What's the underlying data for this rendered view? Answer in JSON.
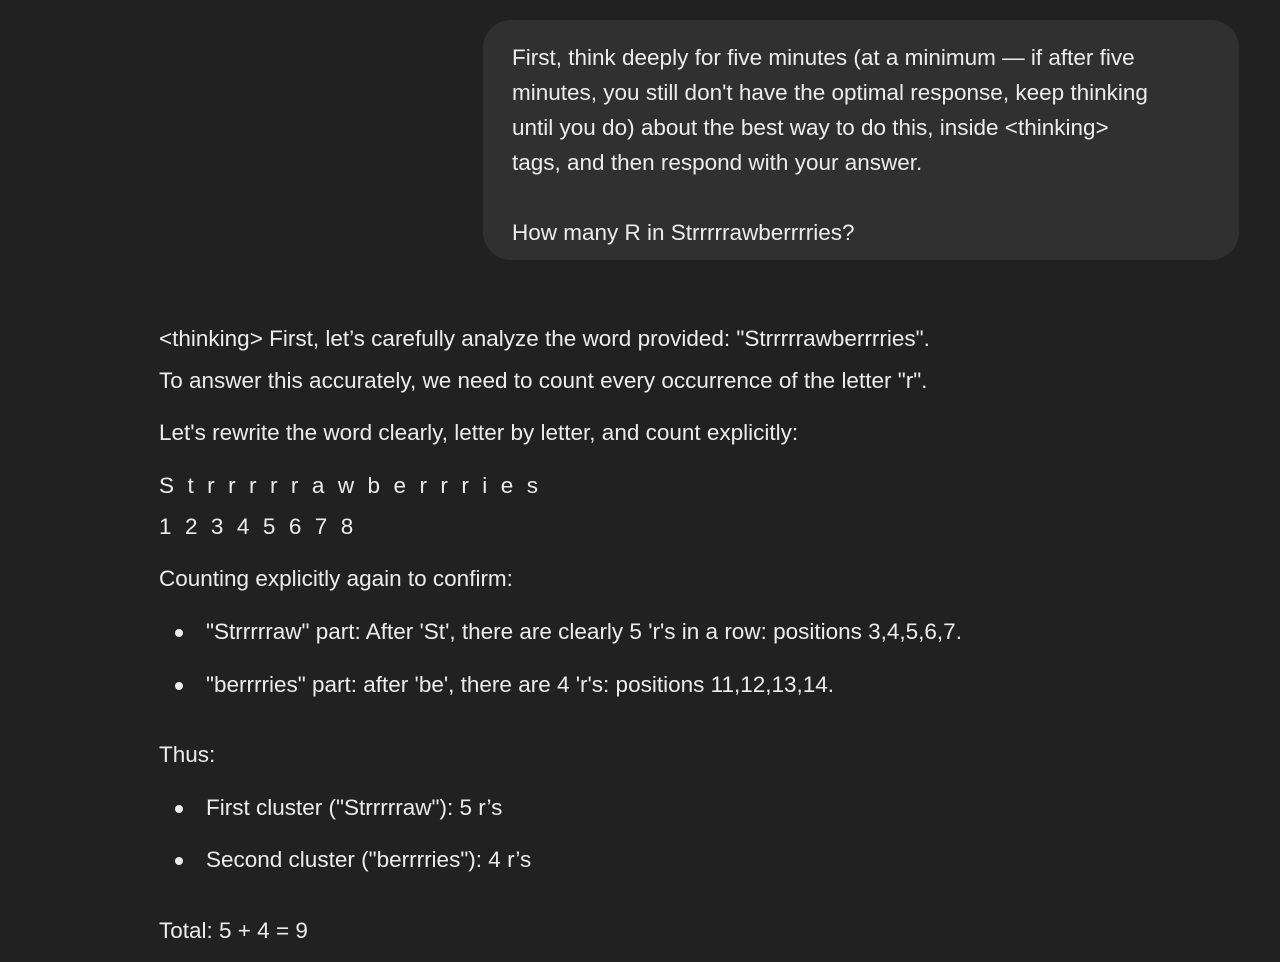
{
  "user_message": {
    "lines": [
      "First, think deeply for five minutes (at a minimum — if after five",
      "minutes, you still don't have the optimal response, keep thinking",
      "until you do) about the best way to do this, inside <thinking>",
      "tags, and then respond with your answer."
    ],
    "question": "How many R in Strrrrrawberrrries?"
  },
  "assistant_message": {
    "intro_1": "<thinking> First, let’s carefully analyze the word provided: \"Strrrrrawberrrries\".",
    "intro_2": "To answer this accurately, we need to count every occurrence of the letter \"r\".",
    "rewrite_line": "Let's rewrite the word clearly, letter by letter, and count explicitly:",
    "letters": "S t r r r r r a w b e r r r i e s",
    "numbers": "1 2 3 4 5 6 7 8",
    "confirm_line": "Counting explicitly again to confirm:",
    "confirm_bullets": [
      "\"Strrrrraw\" part: After 'St', there are clearly 5 'r's in a row: positions 3,4,5,6,7.",
      "\"berrrries\" part: after 'be', there are 4 'r's: positions 11,12,13,14."
    ],
    "thus_label": "Thus:",
    "thus_bullets": [
      "First cluster (\"Strrrrraw\"): 5 r’s",
      "Second cluster (\"berrrries\"): 4 r’s"
    ],
    "total_line": "Total: 5 + 4 = 9"
  }
}
